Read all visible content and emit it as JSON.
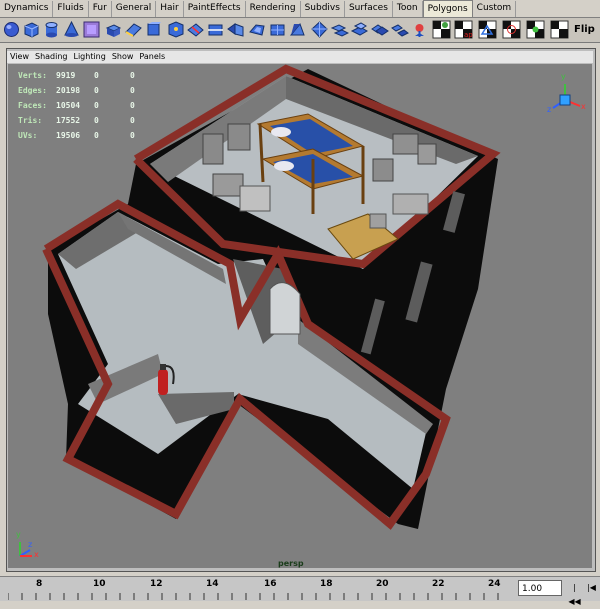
{
  "shelf_tabs": [
    "Dynamics",
    "Fluids",
    "Fur",
    "General",
    "Hair",
    "PaintEffects",
    "Rendering",
    "Subdivs",
    "Surfaces",
    "Toon",
    "Polygons",
    "Custom"
  ],
  "active_tab": "Polygons",
  "shelf": {
    "flip_label": "Flip"
  },
  "panel_menu": [
    "View",
    "Shading",
    "Lighting",
    "Show",
    "Panels"
  ],
  "hud": [
    {
      "label": "Verts:",
      "value": "9919",
      "sel": "0",
      "comp": "0"
    },
    {
      "label": "Edges:",
      "value": "20198",
      "sel": "0",
      "comp": "0"
    },
    {
      "label": "Faces:",
      "value": "10504",
      "sel": "0",
      "comp": "0"
    },
    {
      "label": "Tris:",
      "value": "17552",
      "sel": "0",
      "comp": "0"
    },
    {
      "label": "UVs:",
      "value": "19506",
      "sel": "0",
      "comp": "0"
    }
  ],
  "camera_label": "persp",
  "view_cube": {
    "x": "x",
    "y": "y",
    "z": "z"
  },
  "origin_axis": {
    "y": "y",
    "z": "z",
    "x": "x"
  },
  "timeline": {
    "ticks": [
      "8",
      "10",
      "12",
      "14",
      "16",
      "18",
      "20",
      "22",
      "24"
    ],
    "current_frame": "1.00"
  },
  "colors": {
    "wall_top": "#8a2f28",
    "wall_side": "#0c0c0c",
    "floor": "#b5bcc0",
    "viewport_bg": "#7f7f7f",
    "hud_text": "#d8f0d8"
  }
}
